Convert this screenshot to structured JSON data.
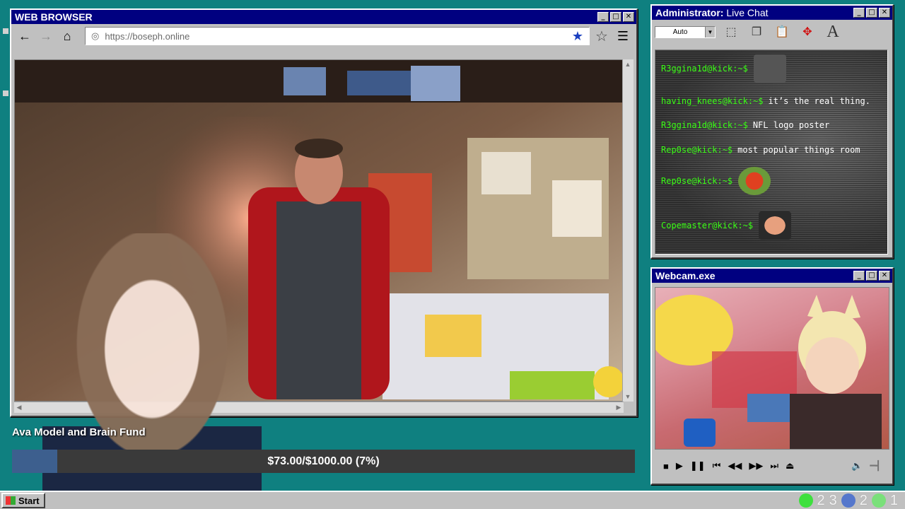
{
  "browser": {
    "title": "WEB BROWSER",
    "url": "https://boseph.online",
    "icons": {
      "back": "arrow-left-icon",
      "forward": "arrow-right-icon",
      "home": "home-icon",
      "globe": "globe-icon",
      "bookmarked": "star-filled-icon",
      "favorite": "star-outline-icon",
      "menu": "hamburger-menu-icon"
    }
  },
  "chat": {
    "title_bold": "Administrator:",
    "title_rest": "Live Chat",
    "size_select": "Auto",
    "messages": [
      {
        "user": "R3ggina1d@kick:~$",
        "text": "",
        "emote": "emote-image"
      },
      {
        "user": "having_knees@kick:~$",
        "text": "it’s the real thing."
      },
      {
        "user": "R3ggina1d@kick:~$",
        "text": "NFL logo poster"
      },
      {
        "user": "Rep0se@kick:~$",
        "text": "most popular things room"
      },
      {
        "user": "Rep0se@kick:~$",
        "text": "",
        "emote": "laughing-emote"
      },
      {
        "user": "Copemaster@kick:~$",
        "text": "",
        "emote": "face-emote"
      }
    ]
  },
  "webcam": {
    "title": "Webcam.exe"
  },
  "fund": {
    "title": "Ava Model and Brain Fund",
    "progress_text": "$73.00/$1000.00 (7%)",
    "progress_fraction": 0.073,
    "fill_color": "#3d5f8e"
  },
  "taskbar": {
    "start_label": "Start",
    "tray": [
      "2",
      "3",
      "2",
      "1"
    ]
  },
  "colors": {
    "desktop": "#0f8080",
    "titlebar": "#000080",
    "chat_user": "#39ff14"
  }
}
